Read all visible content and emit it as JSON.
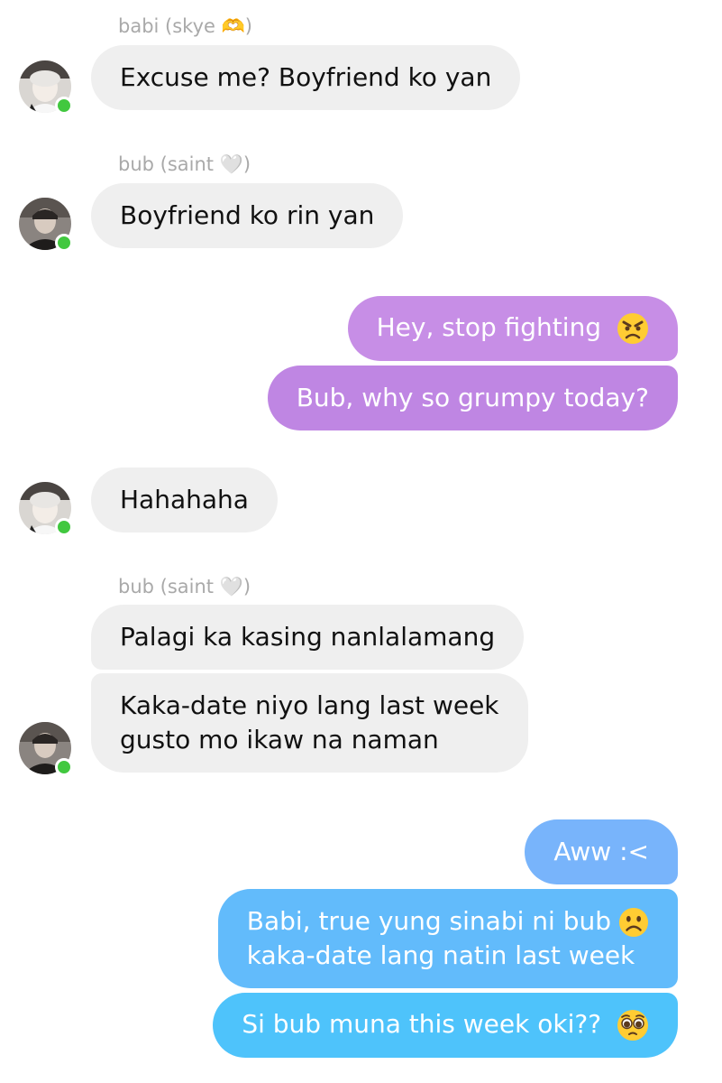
{
  "messages": [
    {
      "sender": "babi (skye 🫶)",
      "text": "Excuse me? Boyfriend ko yan"
    },
    {
      "sender": "bub (saint 🤍)",
      "text": "Boyfriend ko rin yan"
    },
    {
      "text": "Hey, stop fighting",
      "emoji": "angry-face"
    },
    {
      "text": "Bub, why so grumpy today?"
    },
    {
      "text": "Hahahaha"
    },
    {
      "sender": "bub (saint 🤍)",
      "text": "Palagi ka kasing nanlalamang"
    },
    {
      "line1": "Kaka-date niyo lang last week",
      "line2": "gusto mo ikaw na naman"
    },
    {
      "text": "Aww :<"
    },
    {
      "line1": "Babi, true yung sinabi ni bub",
      "line2": "kaka-date lang natin last week",
      "emoji": "frowning-face"
    },
    {
      "text": "Si bub muna this week oki??",
      "emoji": "pleading-face"
    }
  ],
  "colors": {
    "incoming_bubble": "#efefef",
    "purple_bubble": "#c78ee6",
    "blue_bubble": "#62bbfb",
    "online_dot": "#41c83f"
  }
}
